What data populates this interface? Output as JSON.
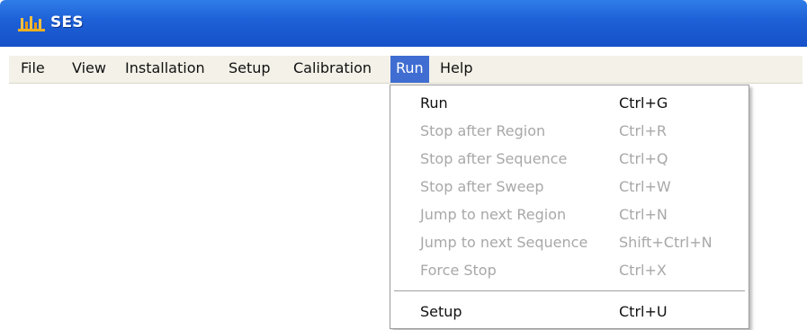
{
  "window": {
    "title": "SES",
    "icon": "ses-app-icon",
    "titlebar_color": "#1d5fd6"
  },
  "menubar": {
    "items": [
      {
        "label": "File"
      },
      {
        "label": "View"
      },
      {
        "label": "Installation"
      },
      {
        "label": "Setup"
      },
      {
        "label": "Calibration"
      },
      {
        "label": "Run",
        "active": true
      },
      {
        "label": "Help"
      }
    ]
  },
  "run_menu": {
    "items": [
      {
        "label": "Run",
        "shortcut": "Ctrl+G",
        "enabled": true
      },
      {
        "label": "Stop after Region",
        "shortcut": "Ctrl+R",
        "enabled": false
      },
      {
        "label": "Stop after Sequence",
        "shortcut": "Ctrl+Q",
        "enabled": false
      },
      {
        "label": "Stop after Sweep",
        "shortcut": "Ctrl+W",
        "enabled": false
      },
      {
        "label": "Jump to next Region",
        "shortcut": "Ctrl+N",
        "enabled": false
      },
      {
        "label": "Jump to next Sequence",
        "shortcut": "Shift+Ctrl+N",
        "enabled": false
      },
      {
        "label": "Force Stop",
        "shortcut": "Ctrl+X",
        "enabled": false
      },
      {
        "label": "Setup",
        "shortcut": "Ctrl+U",
        "enabled": true
      }
    ]
  },
  "colors": {
    "menu_highlight": "#3f6dd2",
    "disabled_text": "#a8a8a8"
  }
}
